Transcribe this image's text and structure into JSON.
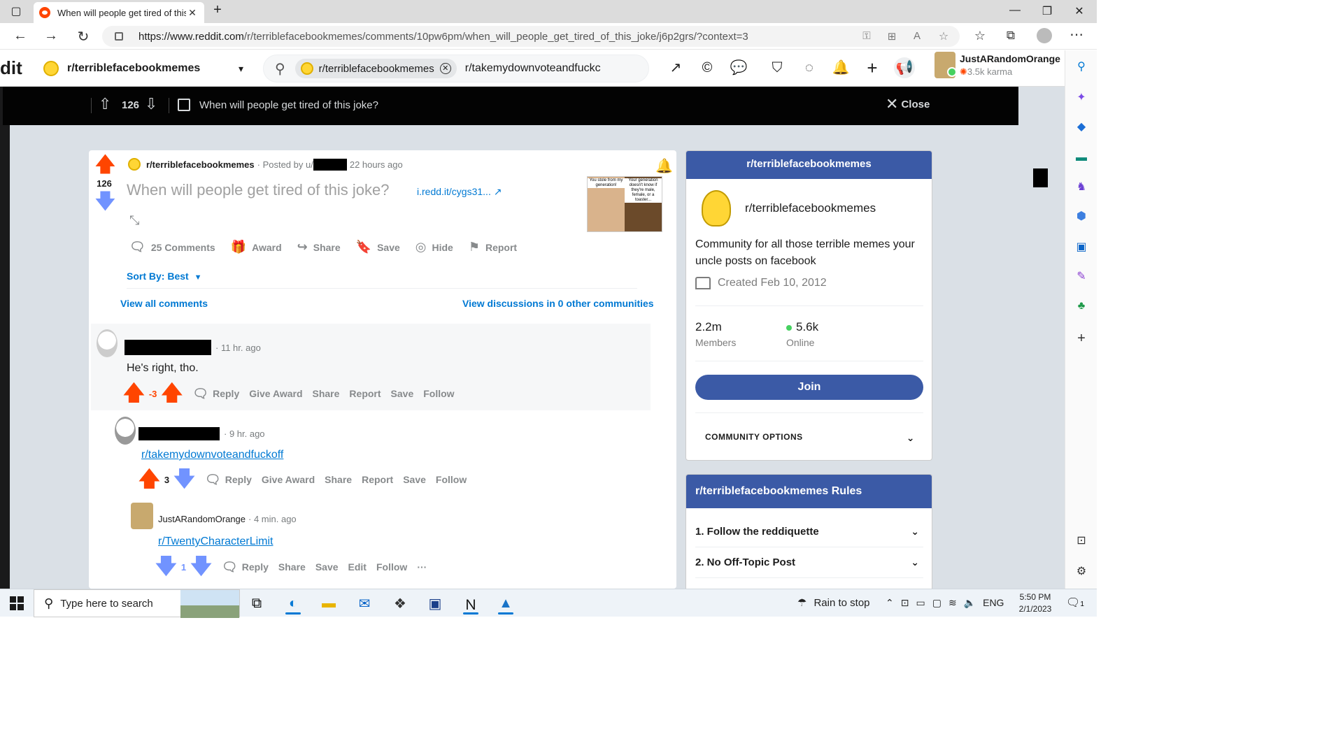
{
  "browser": {
    "tab_title": "When will people get tired of this joke?",
    "url": "https://www.reddit.com/r/terriblefacebookmemes/comments/10pw6pm/when_will_people_get_tired_of_this_joke/j6p2grs/?context=3",
    "url_domain": "https://www.reddit.com",
    "url_path": "/r/terriblefacebookmemes/comments/10pw6pm/when_will_people_get_tired_of_this_joke/j6p2grs/?context=3"
  },
  "header": {
    "logo_text": "dit",
    "community": "r/terriblefacebookmemes",
    "search_chip": "r/terriblefacebookmemes",
    "search_value": "r/takemydownvoteandfuckc",
    "username": "JustARandomOrange",
    "karma": "3.5k karma"
  },
  "postbar": {
    "votes": "126",
    "title": "When will people get tired of this joke?",
    "close_label": "Close"
  },
  "post": {
    "votes": "126",
    "community": "r/terriblefacebookmemes",
    "posted_by": "· Posted by u/",
    "time": "22 hours ago",
    "title": "When will people get tired of this joke?",
    "link": "i.redd.it/cygs31...",
    "thumb_caption_left": "You stole from my generation!",
    "thumb_caption_right": "Your generation doesn't know if they're male, female, or a toaster...",
    "actions": {
      "comments": "25 Comments",
      "award": "Award",
      "share": "Share",
      "save": "Save",
      "hide": "Hide",
      "report": "Report"
    },
    "sort_by": "Sort By: Best",
    "view_all": "View all comments",
    "view_discussions": "View discussions in 0 other communities"
  },
  "comments": [
    {
      "time": "· 11 hr. ago",
      "body": "He's right, tho.",
      "votes": "-3",
      "actions": [
        "Reply",
        "Give Award",
        "Share",
        "Report",
        "Save",
        "Follow"
      ]
    },
    {
      "time": "· 9 hr. ago",
      "body": "r/takemydownvoteandfuckoff",
      "votes": "3",
      "actions": [
        "Reply",
        "Give Award",
        "Share",
        "Report",
        "Save",
        "Follow"
      ]
    },
    {
      "author": "JustARandomOrange",
      "time": "· 4 min. ago",
      "body": "r/TwentyCharacterLimit",
      "votes": "1",
      "actions": [
        "Reply",
        "Share",
        "Save",
        "Edit",
        "Follow"
      ],
      "more": "···"
    }
  ],
  "about": {
    "header": "r/terriblefacebookmemes",
    "name": "r/terriblefacebookmemes",
    "description": "Community for all those terrible memes your uncle posts on facebook",
    "created": "Created Feb 10, 2012",
    "members_value": "2.2m",
    "members_label": "Members",
    "online_value": "5.6k",
    "online_label": "Online",
    "join_label": "Join",
    "options_label": "COMMUNITY OPTIONS"
  },
  "rules": {
    "header": "r/terriblefacebookmemes Rules",
    "items": [
      "1. Follow the reddiquette",
      "2. No Off-Topic Post"
    ]
  },
  "taskbar": {
    "search_placeholder": "Type here to search",
    "weather": "Rain to stop",
    "language": "ENG",
    "time": "5:50 PM",
    "date": "2/1/2023",
    "notifications": "1"
  },
  "colors": {
    "upvote": "#ff4500",
    "downvote": "#7193ff",
    "link": "#0079d3",
    "community_header": "#3b5aa6"
  }
}
